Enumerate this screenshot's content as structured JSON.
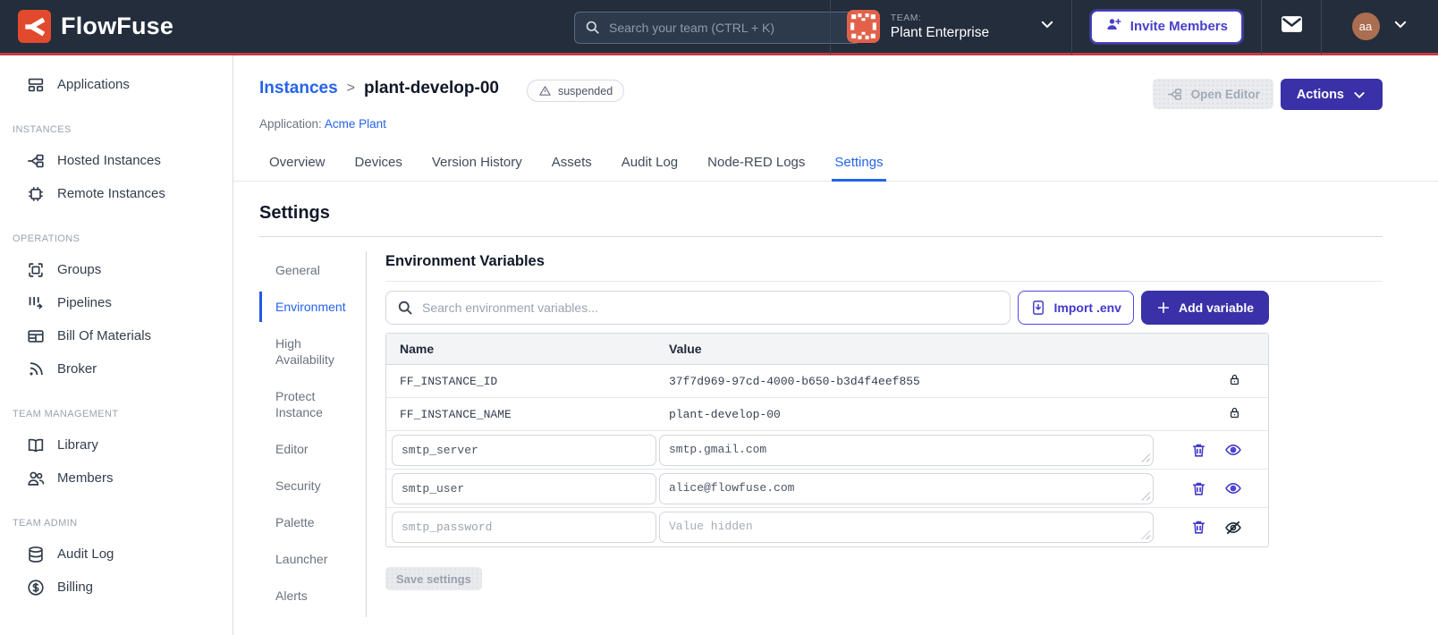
{
  "navbar": {
    "brand": "FlowFuse",
    "search": {
      "placeholder": "Search your team (CTRL + K)"
    },
    "team": {
      "label": "TEAM:",
      "name": "Plant Enterprise"
    },
    "invite_label": "Invite Members",
    "avatar_initials": "aa"
  },
  "sidebar": {
    "sections": {
      "instances": "INSTANCES",
      "operations": "OPERATIONS",
      "team_management": "TEAM MANAGEMENT",
      "team_admin": "TEAM ADMIN"
    },
    "items": [
      {
        "label": "Applications",
        "icon": "applications-icon"
      },
      {
        "label": "Hosted Instances",
        "icon": "hosted-instances-icon"
      },
      {
        "label": "Remote Instances",
        "icon": "remote-instances-icon"
      },
      {
        "label": "Groups",
        "icon": "groups-icon"
      },
      {
        "label": "Pipelines",
        "icon": "pipelines-icon"
      },
      {
        "label": "Bill Of Materials",
        "icon": "bill-of-materials-icon"
      },
      {
        "label": "Broker",
        "icon": "broker-icon"
      },
      {
        "label": "Library",
        "icon": "library-icon"
      },
      {
        "label": "Members",
        "icon": "members-icon"
      },
      {
        "label": "Audit Log",
        "icon": "audit-log-icon"
      },
      {
        "label": "Billing",
        "icon": "billing-icon"
      }
    ]
  },
  "header": {
    "breadcrumb": {
      "parent": "Instances",
      "separator": ">",
      "current": "plant-develop-00"
    },
    "status_badge": "suspended",
    "application_label": "Application:",
    "application_name": "Acme Plant",
    "open_editor_label": "Open Editor",
    "actions_label": "Actions"
  },
  "tabs": {
    "items": [
      "Overview",
      "Devices",
      "Version History",
      "Assets",
      "Audit Log",
      "Node-RED Logs",
      "Settings"
    ],
    "active": "Settings"
  },
  "settings": {
    "title": "Settings",
    "nav_items": [
      "General",
      "Environment",
      "High Availability",
      "Protect Instance",
      "Editor",
      "Security",
      "Palette",
      "Launcher",
      "Alerts"
    ],
    "active": "Environment"
  },
  "env": {
    "title": "Environment Variables",
    "search_placeholder": "Search environment variables...",
    "import_label": "Import .env",
    "add_label": "Add variable",
    "columns": {
      "name": "Name",
      "value": "Value"
    },
    "locked_rows": [
      {
        "name": "FF_INSTANCE_ID",
        "value": "37f7d969-97cd-4000-b650-b3d4f4eef855"
      },
      {
        "name": "FF_INSTANCE_NAME",
        "value": "plant-develop-00"
      }
    ],
    "rows": [
      {
        "name": "smtp_server",
        "value": "smtp.gmail.com"
      },
      {
        "name": "smtp_user",
        "value": "alice@flowfuse.com"
      },
      {
        "name": "smtp_password",
        "value": "",
        "value_placeholder": "Value hidden"
      }
    ],
    "save_label": "Save settings"
  },
  "colors": {
    "navbar_bg": "#232d3c",
    "navbar_red_line": "#c63a45",
    "brand_red": "#e24a2e",
    "accent_indigo": "#3a31a8",
    "link_blue": "#2563eb",
    "team_avatar_orange": "#e2614a",
    "user_avatar_brown": "#ab6e50"
  }
}
